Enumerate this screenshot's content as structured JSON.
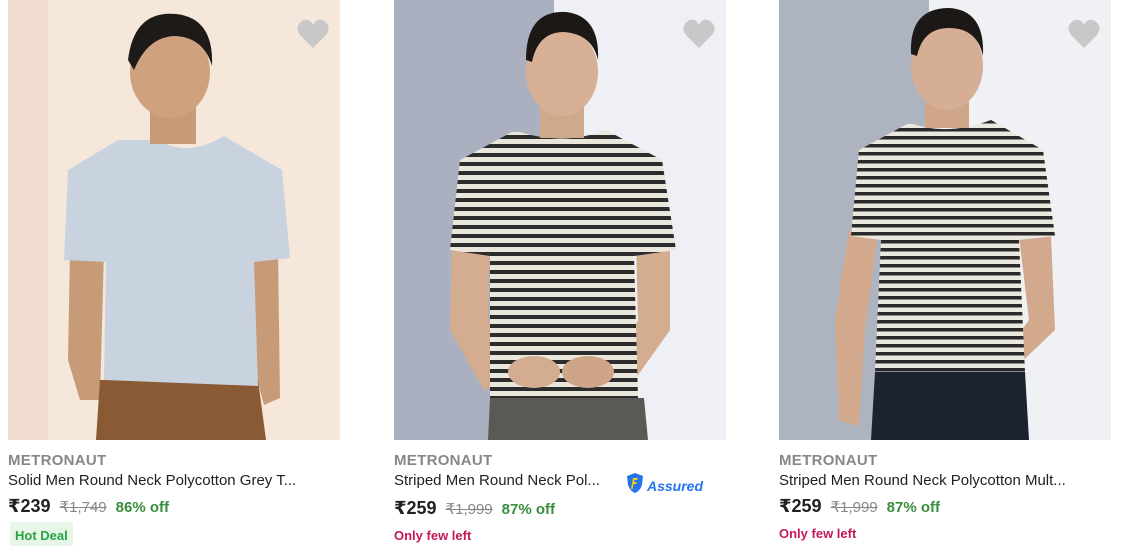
{
  "products": [
    {
      "brand": "METRONAUT",
      "title": "Solid Men Round Neck Polycotton Grey T...",
      "price": "₹239",
      "mrp": "₹1,749",
      "discount": "86% off",
      "badge": "Hot Deal",
      "shirt_color": "#c9d3e0",
      "bg_color": "#f6e6d8",
      "icon": "heart-icon"
    },
    {
      "brand": "METRONAUT",
      "title": "Striped Men Round Neck Pol...",
      "assured_label": "Assured",
      "price": "₹259",
      "mrp": "₹1,999",
      "discount": "87% off",
      "stock_note": "Only few left",
      "icon": "heart-icon"
    },
    {
      "brand": "METRONAUT",
      "title": "Striped Men Round Neck Polycotton Mult...",
      "price": "₹259",
      "mrp": "₹1,999",
      "discount": "87% off",
      "stock_note": "Only few left",
      "icon": "heart-icon"
    }
  ],
  "colors": {
    "discount_green": "#388e3c",
    "stock_pink": "#c2185b",
    "assured_blue": "#2874f0",
    "wishlist_grey": "#c8c8c8"
  }
}
